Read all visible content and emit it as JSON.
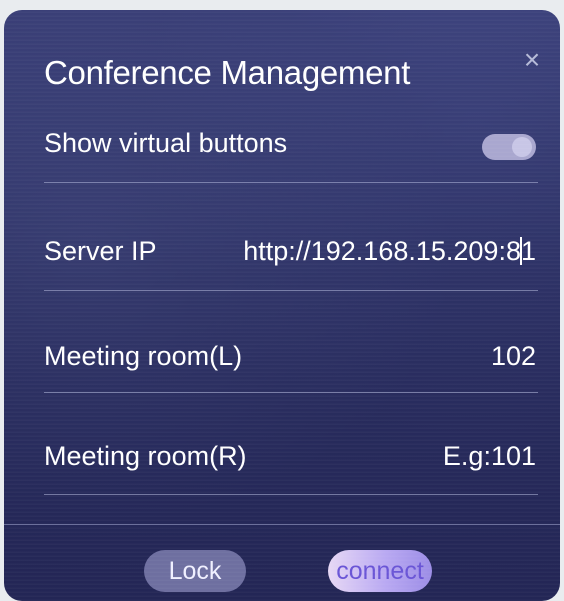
{
  "dialog": {
    "title": "Conference Management",
    "close_glyph": "×"
  },
  "settings": {
    "show_virtual_buttons": {
      "label": "Show virtual buttons",
      "enabled": false
    },
    "server_ip": {
      "label": "Server IP",
      "value_before_caret": "http://192.168.15.209:8",
      "value_after_caret": "1"
    },
    "meeting_room_left": {
      "label": "Meeting room(L)",
      "value": "102"
    },
    "meeting_room_right": {
      "label": "Meeting room(R)",
      "placeholder": "E.g:101"
    }
  },
  "actions": {
    "lock_label": "Lock",
    "connect_label": "connect"
  },
  "colors": {
    "panel_bg": "#2f3366",
    "lock_button": "#6e6fa0",
    "connect_button": "#b9a9f2",
    "toggle_track": "#a9a7cf"
  },
  "icons": {
    "close": "close-icon"
  }
}
